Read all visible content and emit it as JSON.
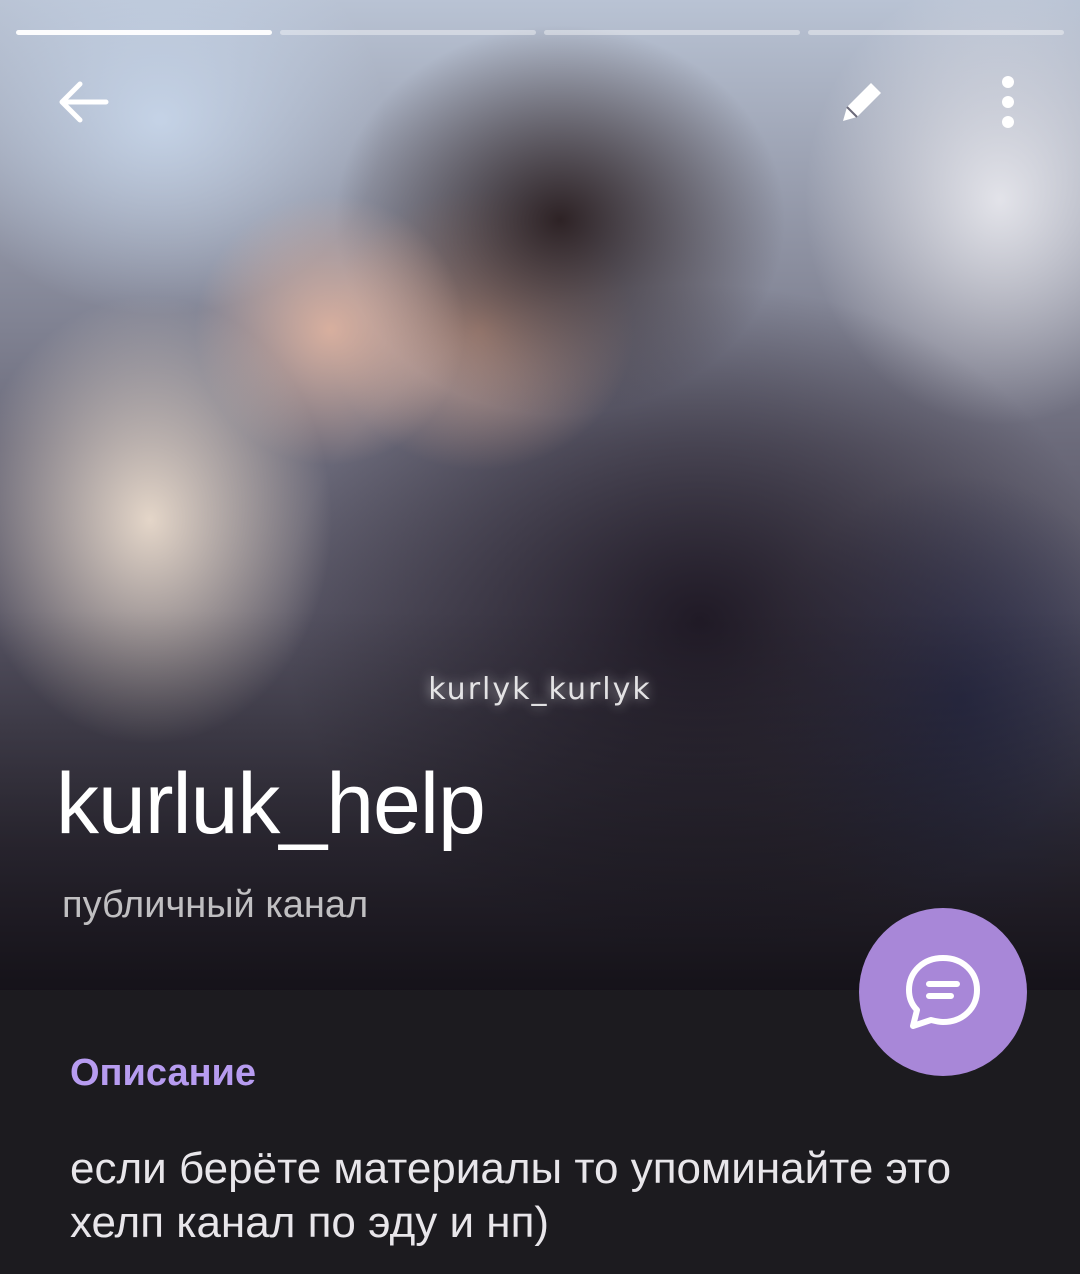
{
  "header": {
    "story_segments": 4,
    "active_segment": 1,
    "icons": [
      "back-arrow-icon",
      "edit-pencil-icon",
      "more-vert-icon"
    ]
  },
  "hero": {
    "watermark": "kurlyk_kurlyk"
  },
  "channel": {
    "title": "kurluk_help",
    "subtitle": "публичный канал"
  },
  "description": {
    "label": "Описание",
    "text": "если берёте материалы то упоминайте это хелп канал по эду и нп)"
  },
  "fab": {
    "icon": "chat-bubble-icon"
  },
  "colors": {
    "accent": "#a887d8",
    "label": "#b79cf0",
    "background": "#1c1b1f"
  }
}
